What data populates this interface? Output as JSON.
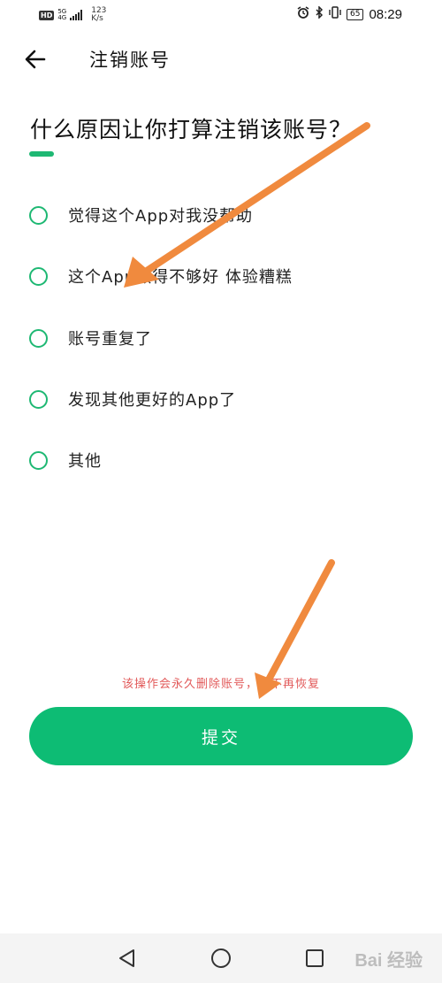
{
  "status_bar": {
    "hd": "HD",
    "network_top": "5G",
    "network_bottom": "4G",
    "speed_value": "123",
    "speed_unit": "K/s",
    "battery": "65",
    "time": "08:29"
  },
  "header": {
    "title": "注销账号"
  },
  "question": "什么原因让你打算注销该账号？",
  "options": [
    {
      "label": "觉得这个App对我没帮助"
    },
    {
      "label": "这个App做得不够好 体验糟糕"
    },
    {
      "label": "账号重复了"
    },
    {
      "label": "发现其他更好的App了"
    },
    {
      "label": "其他"
    }
  ],
  "warning": "该操作会永久删除账号，且不再恢复",
  "submit_label": "提交",
  "watermark": "Bai 经验",
  "colors": {
    "accent": "#1eb873",
    "button": "#0dbc74",
    "warning": "#e25b5b",
    "arrow": "#f08a3e"
  }
}
